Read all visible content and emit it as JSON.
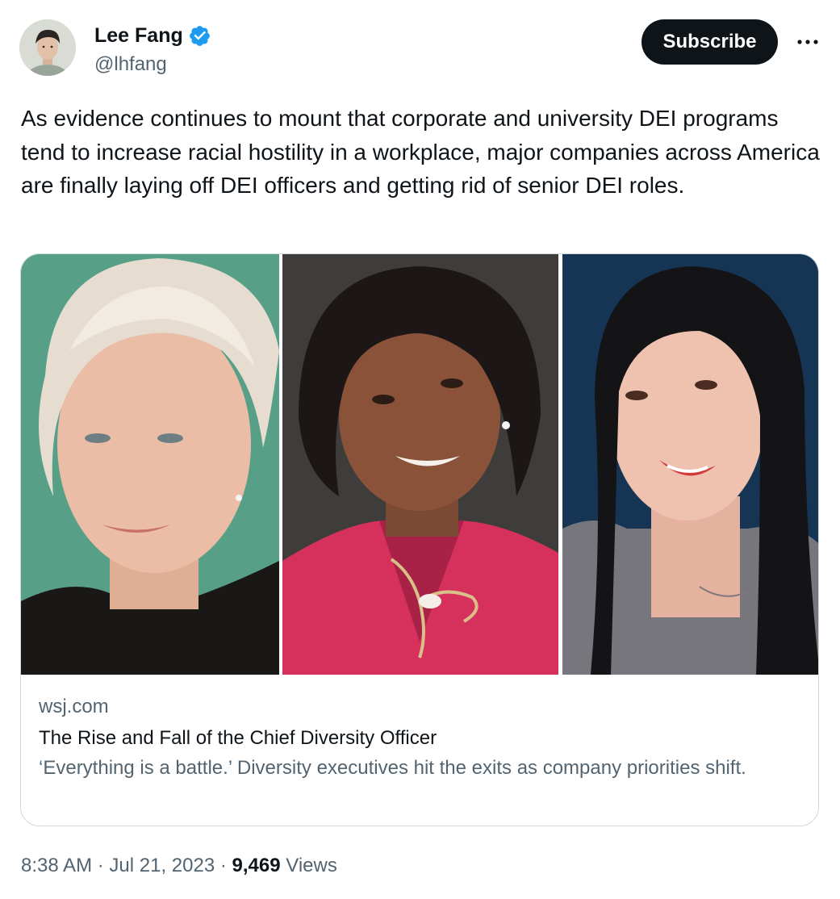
{
  "author": {
    "display_name": "Lee Fang",
    "handle": "@lhfang",
    "verified": true
  },
  "actions": {
    "subscribe_label": "Subscribe",
    "more_icon": "more-horizontal-icon"
  },
  "tweet": {
    "text": "As evidence continues to mount that corporate and university DEI programs tend to increase racial hostility in a workplace, major companies across America are finally laying off DEI officers and getting rid of senior DEI roles."
  },
  "card": {
    "domain": "wsj.com",
    "title": "The Rise and Fall of the Chief Diversity Officer",
    "description": "‘Everything is a battle.’ Diversity executives hit the exits as company priorities shift."
  },
  "footer": {
    "time": "8:38 AM",
    "separator": "·",
    "date": "Jul 21, 2023",
    "views_count": "9,469",
    "views_label": "Views"
  },
  "colors": {
    "text_primary": "#0f1419",
    "text_secondary": "#536471",
    "verified_blue": "#1d9bf0",
    "border": "#cfd9de"
  }
}
